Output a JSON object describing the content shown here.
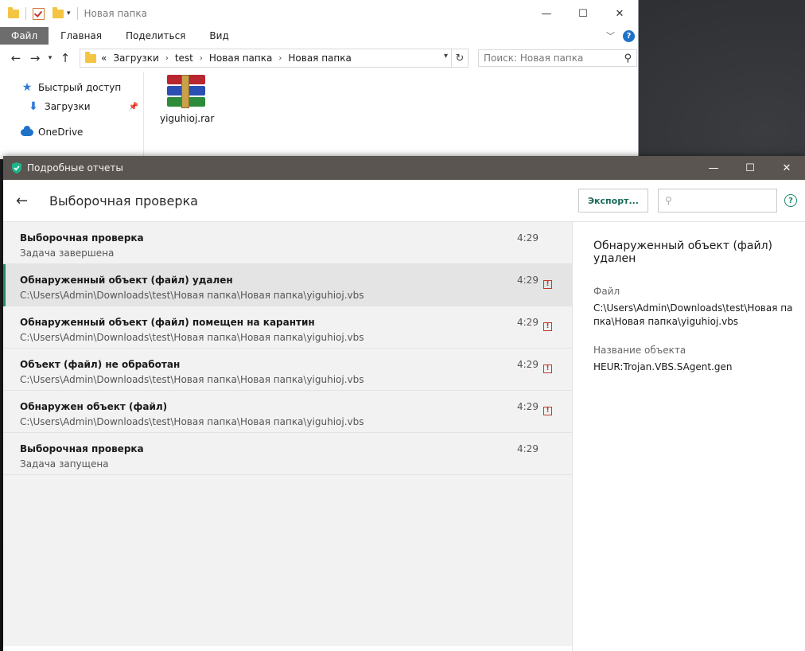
{
  "explorer": {
    "title": "Новая папка",
    "ribbon_tabs": [
      "Файл",
      "Главная",
      "Поделиться",
      "Вид"
    ],
    "breadcrumb": {
      "prefix": "«",
      "parts": [
        "Загрузки",
        "test",
        "Новая папка",
        "Новая папка"
      ]
    },
    "search_placeholder": "Поиск: Новая папка",
    "nav": {
      "quick_access": "Быстрый доступ",
      "downloads": "Загрузки",
      "onedrive": "OneDrive"
    },
    "file": {
      "name": "yiguhioj.rar"
    }
  },
  "report": {
    "window_title": "Подробные отчеты",
    "heading": "Выборочная проверка",
    "export_label": "Экспорт...",
    "search_placeholder": "",
    "help": "?",
    "rows": [
      {
        "title": "Выборочная проверка",
        "sub": "Задача завершена",
        "time": "4:29",
        "warning": false
      },
      {
        "title": "Обнаруженный объект (файл) удален",
        "sub": "C:\\Users\\Admin\\Downloads\\test\\Новая папка\\Новая папка\\yiguhioj.vbs",
        "time": "4:29",
        "warning": true
      },
      {
        "title": "Обнаруженный объект (файл) помещен на карантин",
        "sub": "C:\\Users\\Admin\\Downloads\\test\\Новая папка\\Новая папка\\yiguhioj.vbs",
        "time": "4:29",
        "warning": true
      },
      {
        "title": "Объект (файл) не обработан",
        "sub": "C:\\Users\\Admin\\Downloads\\test\\Новая папка\\Новая папка\\yiguhioj.vbs",
        "time": "4:29",
        "warning": true
      },
      {
        "title": "Обнаружен объект (файл)",
        "sub": "C:\\Users\\Admin\\Downloads\\test\\Новая папка\\Новая папка\\yiguhioj.vbs",
        "time": "4:29",
        "warning": true
      },
      {
        "title": "Выборочная проверка",
        "sub": "Задача запущена",
        "time": "4:29",
        "warning": false
      }
    ],
    "detail": {
      "title": "Обнаруженный объект (файл) удален",
      "file_label": "Файл",
      "file_value": "C:\\Users\\Admin\\Downloads\\test\\Новая папка\\Новая папка\\yiguhioj.vbs",
      "name_label": "Название объекта",
      "name_value": "HEUR:Trojan.VBS.SAgent.gen"
    }
  },
  "colors": {
    "accent_green": "#1f8f6a",
    "title_bar": "#5a5550",
    "warning_red": "#c0392b",
    "ribbon_file_tab": "#6d6d6d"
  }
}
